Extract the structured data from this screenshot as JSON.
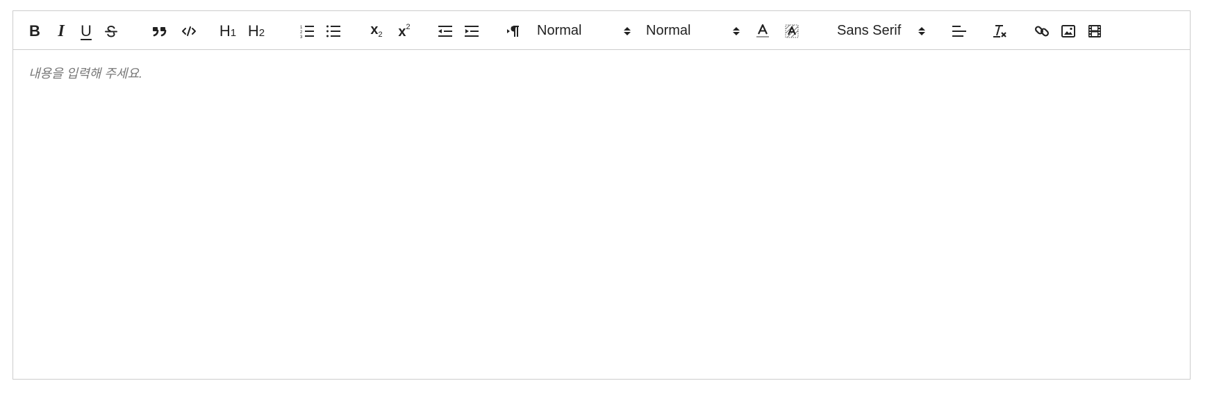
{
  "editor": {
    "placeholder": "내용을 입력해 주세요.",
    "buttons": {
      "bold": "B",
      "italic": "I",
      "underline": "U",
      "h1_main": "H",
      "h1_sub": "1",
      "h2_main": "H",
      "h2_sub": "2",
      "sub_main": "x",
      "sub_index": "2",
      "sup_main": "x",
      "sup_index": "2"
    },
    "pickers": {
      "header": "Normal",
      "size": "Normal",
      "font": "Sans Serif"
    },
    "colors": {
      "border": "#cccccc",
      "icon": "#222222",
      "placeholder": "#777777"
    }
  }
}
